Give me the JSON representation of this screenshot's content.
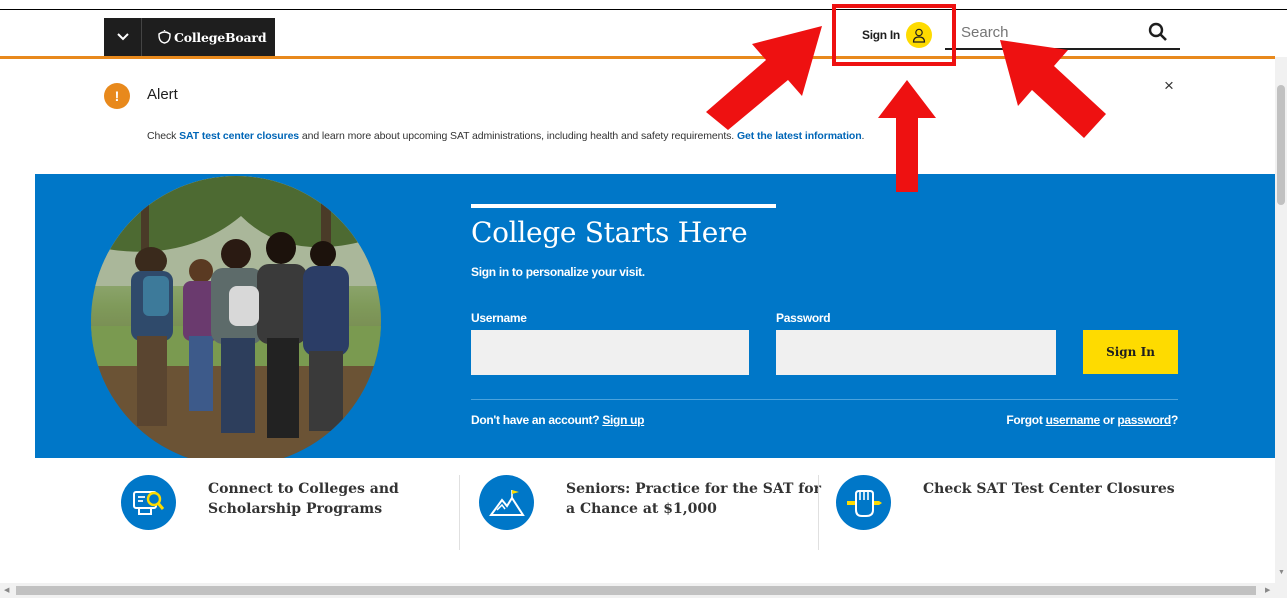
{
  "header": {
    "menu_toggle": "⌄",
    "logo_text": "CollegeBoard",
    "sign_in_label": "Sign In",
    "search_placeholder": "Search"
  },
  "alert": {
    "title": "Alert",
    "text_prefix": "Check ",
    "link1": "SAT test center closures",
    "text_middle": " and learn more about upcoming SAT administrations, including health and safety requirements. ",
    "link2": "Get the latest information",
    "text_suffix": ".",
    "close_label": "×"
  },
  "hero": {
    "title": "College Starts Here",
    "subtitle": "Sign in to personalize your visit.",
    "username_label": "Username",
    "password_label": "Password",
    "sign_in_button": "Sign In",
    "no_account_text": "Don't have an account? ",
    "sign_up_link": "Sign up",
    "forgot_text": "Forgot ",
    "username_link": "username",
    "or_text": " or ",
    "password_link": "password",
    "question": "?"
  },
  "promos": [
    {
      "title": "Connect to Colleges and Scholarship Programs",
      "icon": "computer-search-icon"
    },
    {
      "title": "Seniors: Practice for the SAT for a Chance at $1,000",
      "icon": "mountain-flag-icon"
    },
    {
      "title": "Check SAT Test Center Closures",
      "icon": "fist-pencil-icon"
    }
  ],
  "colors": {
    "brand_blue": "#0077c8",
    "accent_yellow": "#fedb00",
    "alert_orange": "#e8891c",
    "annotation_red": "#ee1111"
  }
}
